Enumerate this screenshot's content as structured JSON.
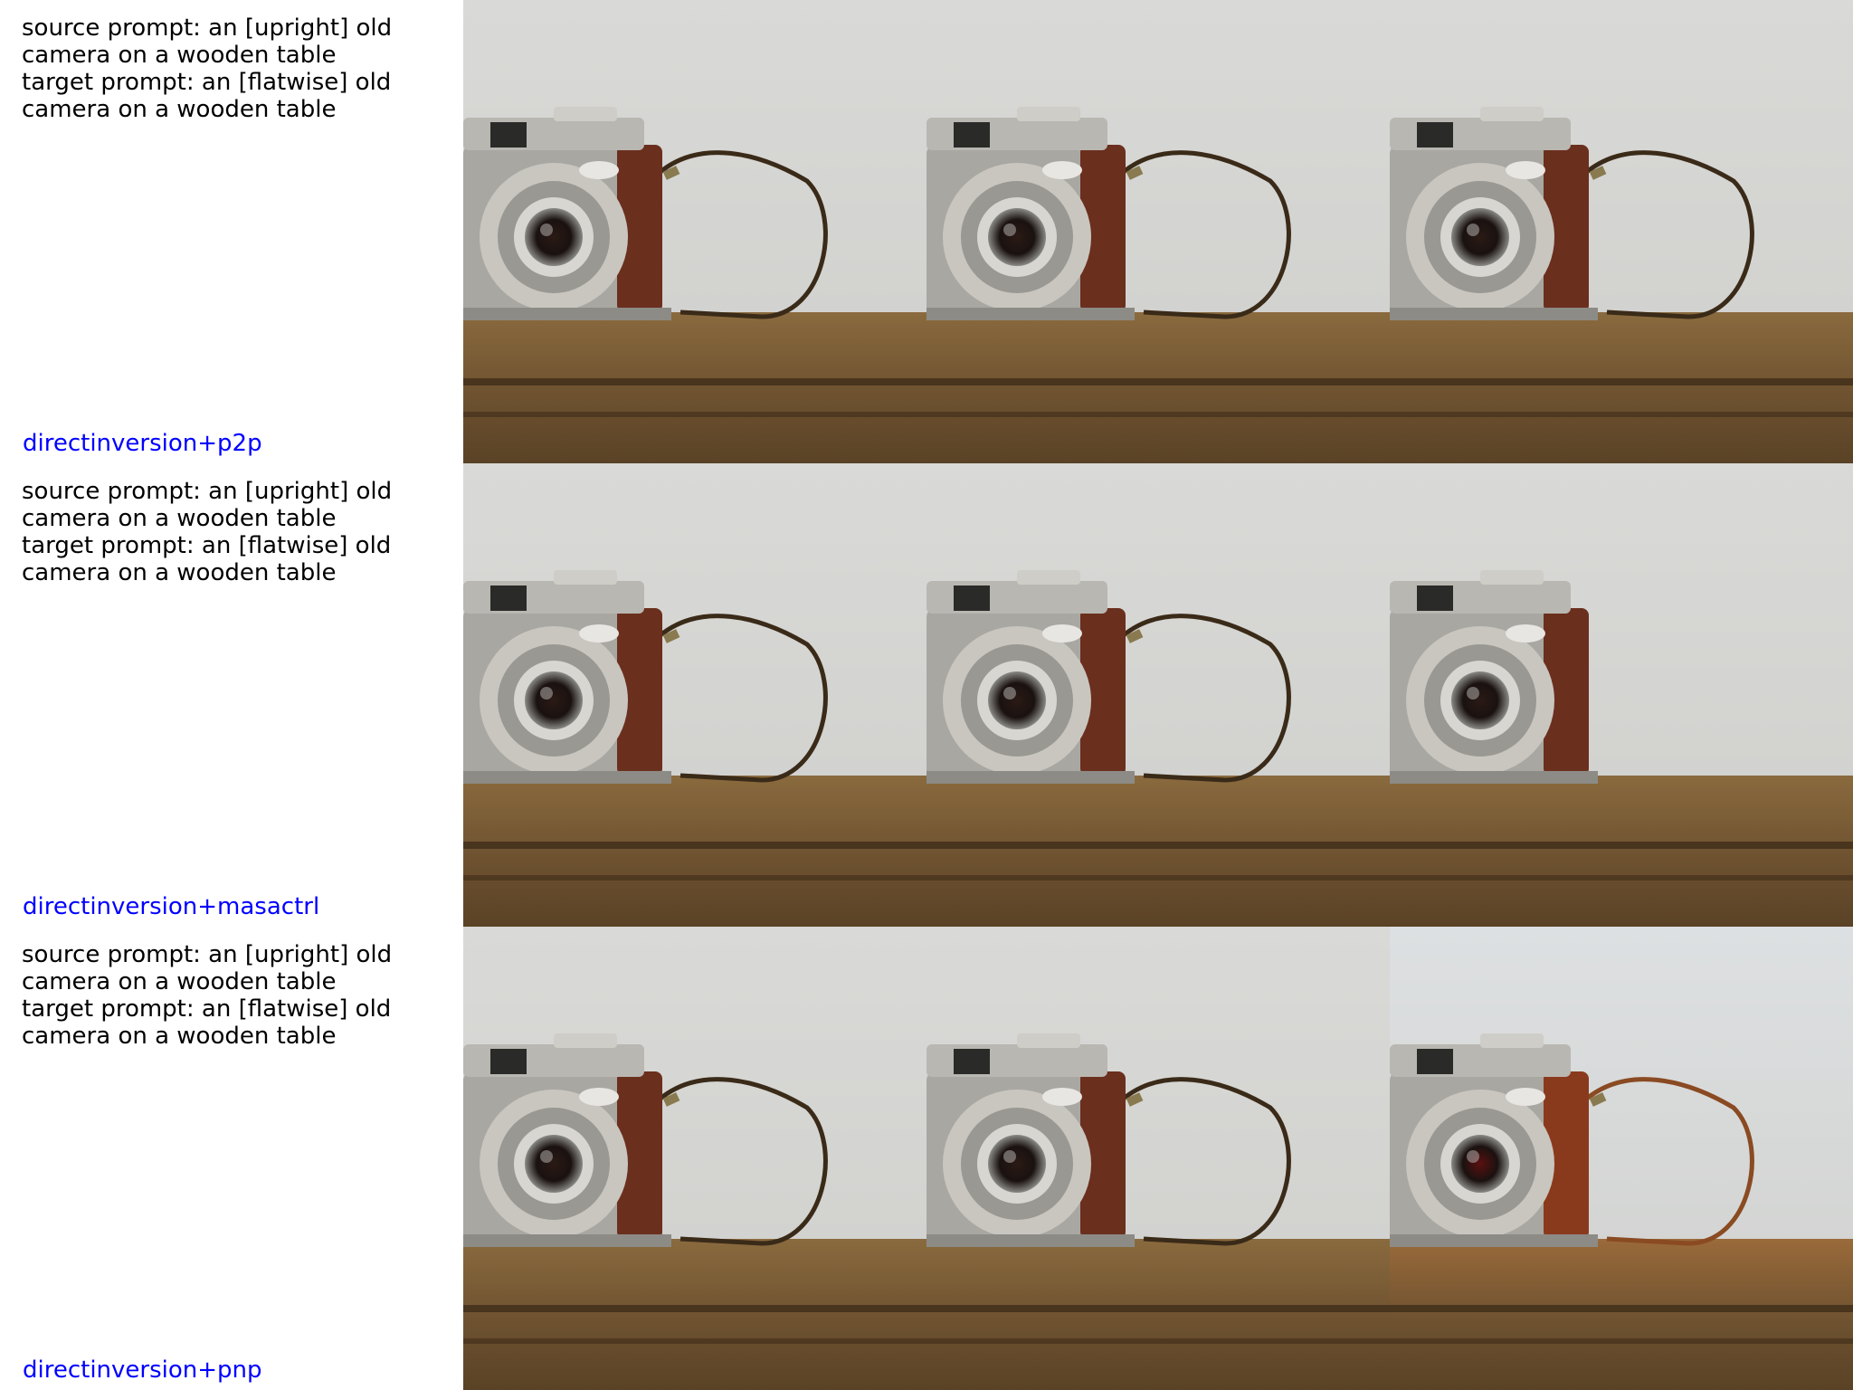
{
  "rows": [
    {
      "source_prompt": "source prompt: an [upright] old camera on a wooden table",
      "target_prompt": "target prompt: an [flatwise] old camera on a wooden table",
      "method": "directinversion+p2p"
    },
    {
      "source_prompt": "source prompt: an [upright] old camera on a wooden table",
      "target_prompt": "target prompt: an [flatwise] old camera on a wooden table",
      "method": "directinversion+masactrl"
    },
    {
      "source_prompt": "source prompt: an [upright] old camera on a wooden table",
      "target_prompt": "target prompt: an [flatwise] old camera on a wooden table",
      "method": "directinversion+pnp"
    }
  ],
  "colors": {
    "method_label": "#0000ff",
    "wall": "#d9d9d7",
    "table": "#8a6a3e",
    "camera_leather": "#6b2f1e",
    "camera_metal": "#a9a7a2",
    "strap": "#3a2a18"
  }
}
